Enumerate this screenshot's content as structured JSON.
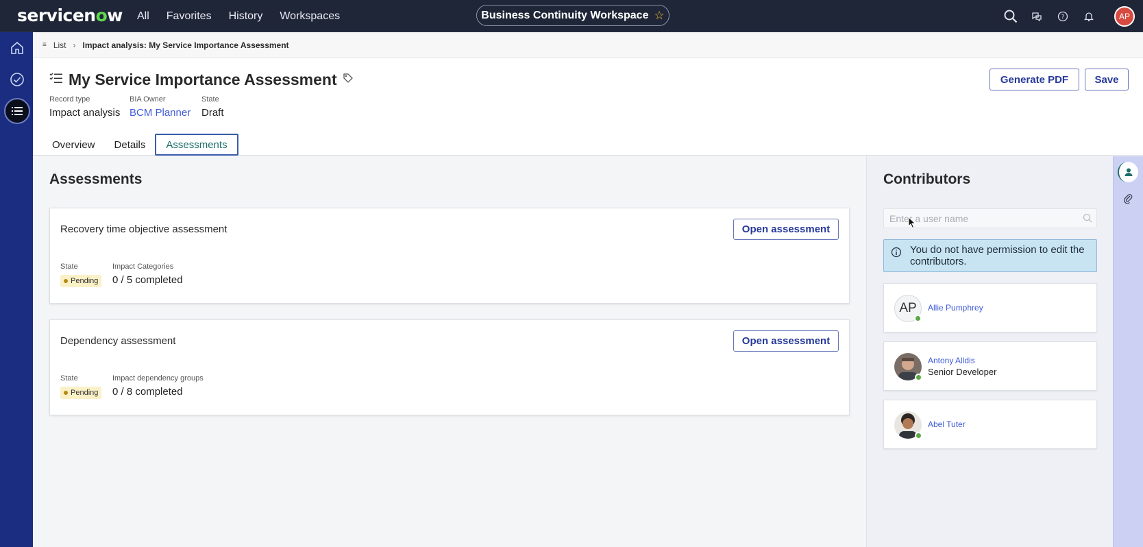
{
  "topnav": {
    "logo_pre": "servicen",
    "logo_o": "o",
    "logo_post": "w",
    "links": [
      "All",
      "Favorites",
      "History",
      "Workspaces"
    ],
    "workspace": "Business Continuity Workspace",
    "avatar_initials": "AP"
  },
  "breadcrumb": {
    "list": "List",
    "current": "Impact analysis: My Service Importance Assessment"
  },
  "header": {
    "title": "My Service Importance Assessment",
    "fields": [
      {
        "label": "Record type",
        "value": "Impact analysis"
      },
      {
        "label": "BIA Owner",
        "value": "BCM Planner"
      },
      {
        "label": "State",
        "value": "Draft"
      }
    ],
    "generate_pdf": "Generate PDF",
    "save": "Save",
    "tabs": [
      "Overview",
      "Details",
      "Assessments"
    ],
    "active_tab": "Assessments"
  },
  "main": {
    "heading": "Assessments",
    "cards": [
      {
        "title": "Recovery time objective assessment",
        "button": "Open assessment",
        "state_label": "State",
        "state_value": "Pending",
        "progress_label": "Impact Categories",
        "progress_value": "0 / 5 completed"
      },
      {
        "title": "Dependency assessment",
        "button": "Open assessment",
        "state_label": "State",
        "state_value": "Pending",
        "progress_label": "Impact dependency groups",
        "progress_value": "0 / 8 completed"
      }
    ]
  },
  "contributors": {
    "heading": "Contributors",
    "search_placeholder": "Enter a user name",
    "info": "You do not have permission to edit the contributors.",
    "people": [
      {
        "initials": "AP",
        "name": "Allie Pumphrey",
        "role": ""
      },
      {
        "initials": "",
        "name": "Antony Alldis",
        "role": "Senior Developer"
      },
      {
        "initials": "",
        "name": "Abel Tuter",
        "role": ""
      }
    ]
  },
  "colors": {
    "nav_bg": "#1f2638",
    "rail_bg": "#1b2d80",
    "accent": "#27399a",
    "link": "#3f5bd6",
    "pending_badge": "#fbf1c7",
    "info_bg": "#c8e4f3"
  }
}
